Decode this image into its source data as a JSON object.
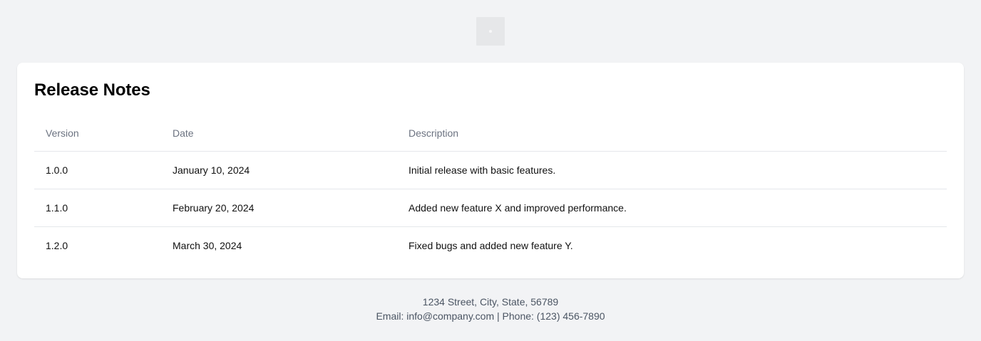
{
  "header": {
    "logo_icon": "placeholder-image-icon"
  },
  "release_notes": {
    "title": "Release Notes",
    "columns": [
      "Version",
      "Date",
      "Description"
    ],
    "rows": [
      {
        "version": "1.0.0",
        "date": "January 10, 2024",
        "description": "Initial release with basic features."
      },
      {
        "version": "1.1.0",
        "date": "February 20, 2024",
        "description": "Added new feature X and improved performance."
      },
      {
        "version": "1.2.0",
        "date": "March 30, 2024",
        "description": "Fixed bugs and added new feature Y."
      }
    ]
  },
  "footer": {
    "address": "1234 Street, City, State, 56789",
    "contact": "Email: info@company.com | Phone: (123) 456-7890"
  },
  "colors": {
    "page_background": "#f2f3f5",
    "card_background": "#ffffff",
    "header_text": "#6b7280",
    "footer_text": "#4b5563",
    "divider": "#e5e7eb"
  }
}
